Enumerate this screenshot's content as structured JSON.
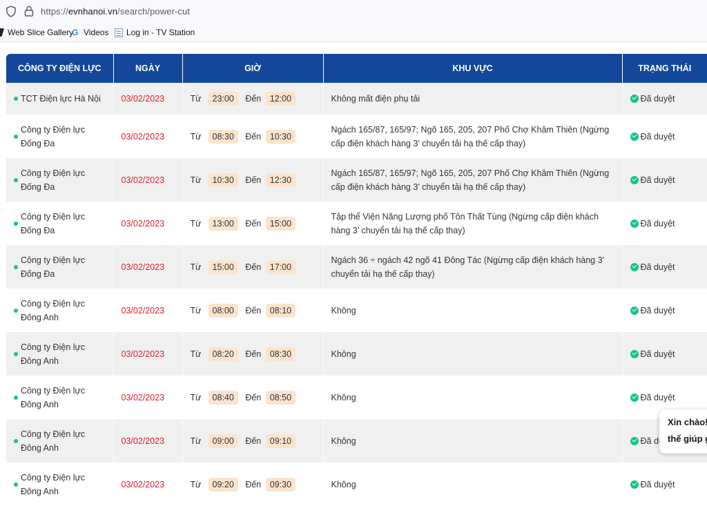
{
  "browser": {
    "url_scheme": "https://",
    "url_host": "evnhanoi.vn",
    "url_path": "/search/power-cut",
    "bookmarks": [
      {
        "label": "Web Slice Gallery",
        "icon": "web-slice-icon"
      },
      {
        "label": "Videos",
        "icon": "google-icon"
      },
      {
        "label": "Log in - TV Station",
        "icon": "page-icon"
      }
    ]
  },
  "table": {
    "headers": {
      "company": "CÔNG TY ĐIỆN LỰC",
      "date": "NGÀY",
      "time": "GIỜ",
      "area": "KHU VỰC",
      "status": "TRẠNG THÁI"
    },
    "from_label": "Từ",
    "to_label": "Đến",
    "rows": [
      {
        "company": "TCT Điện lực Hà Nội",
        "date": "03/02/2023",
        "from": "23:00",
        "to": "12:00",
        "area": "Không mất điện phụ tải",
        "status": "Đã duyệt"
      },
      {
        "company": "Công ty Điện lực Đống Đa",
        "date": "03/02/2023",
        "from": "08:30",
        "to": "10:30",
        "area": "Ngách 165/87, 165/97; Ngõ 165, 205, 207 Phố Chợ Khâm Thiên (Ngừng cấp điện khách hàng 3’ chuyển tải hạ thế cấp thay)",
        "status": "Đã duyệt"
      },
      {
        "company": "Công ty Điện lực Đống Đa",
        "date": "03/02/2023",
        "from": "10:30",
        "to": "12:30",
        "area": "Ngách 165/87, 165/97; Ngõ 165, 205, 207 Phố Chợ Khâm Thiên (Ngừng cấp điện khách hàng 3’ chuyển tải hạ thế cấp thay)",
        "status": "Đã duyệt"
      },
      {
        "company": "Công ty Điện lực Đống Đa",
        "date": "03/02/2023",
        "from": "13:00",
        "to": "15:00",
        "area": "Tập thể Viện Năng Lượng phố Tôn Thất Tùng (Ngừng cấp điện khách hàng 3’ chuyển tải hạ thế cấp thay)",
        "status": "Đã duyệt"
      },
      {
        "company": "Công ty Điện lực Đống Đa",
        "date": "03/02/2023",
        "from": "15:00",
        "to": "17:00",
        "area": "Ngách 36 ÷ ngách 42 ngõ 41 Đông Tác (Ngừng cấp điện khách hàng 3’ chuyển tải hạ thế cấp thay)",
        "status": "Đã duyệt"
      },
      {
        "company": "Công ty Điện lực Đông Anh",
        "date": "03/02/2023",
        "from": "08:00",
        "to": "08:10",
        "area": "Không",
        "status": "Đã duyệt"
      },
      {
        "company": "Công ty Điện lực Đông Anh",
        "date": "03/02/2023",
        "from": "08:20",
        "to": "08:30",
        "area": "Không",
        "status": "Đã duyệt"
      },
      {
        "company": "Công ty Điện lực Đông Anh",
        "date": "03/02/2023",
        "from": "08:40",
        "to": "08:50",
        "area": "Không",
        "status": "Đã duyệt"
      },
      {
        "company": "Công ty Điện lực Đông Anh",
        "date": "03/02/2023",
        "from": "09:00",
        "to": "09:10",
        "area": "Không",
        "status": "Đã duyệt"
      },
      {
        "company": "Công ty Điện lực Đông Anh",
        "date": "03/02/2023",
        "from": "09:20",
        "to": "09:30",
        "area": "Không",
        "status": "Đã duyệt"
      }
    ]
  },
  "chat": {
    "line1": "Xin chào!",
    "line2": "thể giúp g"
  },
  "colors": {
    "header_bg": "#134799",
    "date_red": "#e01e2b",
    "status_green": "#12c48b",
    "time_pill": "#fbe4cb",
    "row_grey": "#f0f0f0"
  }
}
